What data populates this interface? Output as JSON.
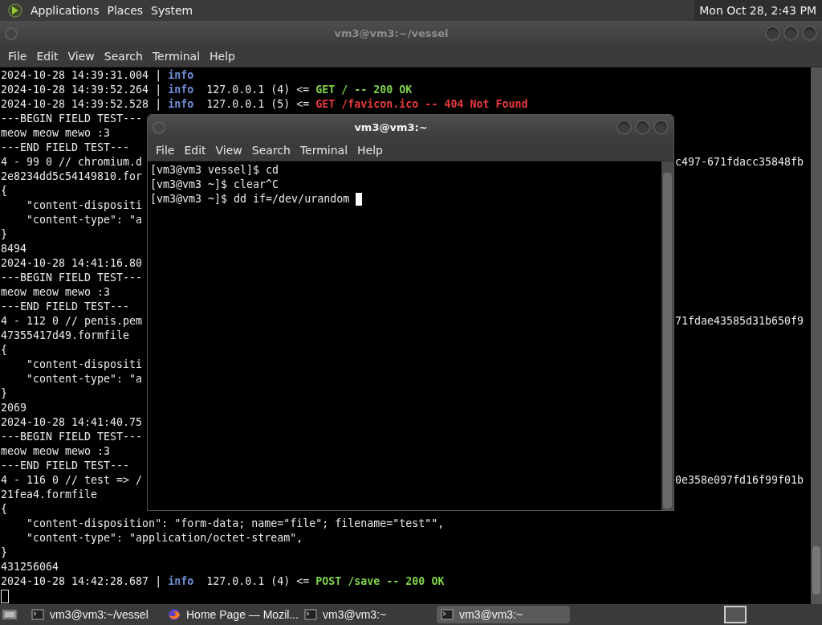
{
  "top_panel": {
    "menus": [
      "Applications",
      "Places",
      "System"
    ],
    "clock": "Mon Oct 28, 2:43 PM"
  },
  "windows": [
    {
      "title": "vm3@vm3:~/vessel",
      "active": false,
      "menu": [
        "File",
        "Edit",
        "View",
        "Search",
        "Terminal",
        "Help"
      ],
      "lines": [
        {
          "segments": [
            {
              "text": "2024-10-28 14:39:31.004 | ",
              "kind": "plain"
            },
            {
              "text": "info",
              "kind": "info"
            }
          ]
        },
        {
          "segments": [
            {
              "text": "2024-10-28 14:39:52.264 | ",
              "kind": "plain"
            },
            {
              "text": "info",
              "kind": "info"
            },
            {
              "text": "  127.0.0.1 (4) <= ",
              "kind": "plain"
            },
            {
              "text": "GET / -- 200 OK",
              "kind": "ok"
            }
          ]
        },
        {
          "segments": [
            {
              "text": "2024-10-28 14:39:52.528 | ",
              "kind": "plain"
            },
            {
              "text": "info",
              "kind": "info"
            },
            {
              "text": "  127.0.0.1 (5) <= ",
              "kind": "plain"
            },
            {
              "text": "GET /favicon.ico -- 404 Not Found",
              "kind": "error"
            }
          ]
        },
        {
          "segments": [
            {
              "text": "---BEGIN FIELD TEST---",
              "kind": "plain"
            }
          ]
        },
        {
          "segments": [
            {
              "text": "meow meow mewo :3",
              "kind": "plain"
            }
          ]
        },
        {
          "segments": [
            {
              "text": "---END FIELD TEST---",
              "kind": "plain"
            }
          ]
        },
        {
          "segments": [
            {
              "text": "4 - 99 0 // chromium.d",
              "kind": "plain"
            }
          ],
          "tail": "c497-671fdacc35848fb"
        },
        {
          "segments": [
            {
              "text": "2e8234dd5c54149810.for",
              "kind": "plain"
            }
          ]
        },
        {
          "segments": [
            {
              "text": "{",
              "kind": "plain"
            }
          ]
        },
        {
          "segments": [
            {
              "text": "    \"content-dispositi",
              "kind": "plain"
            }
          ]
        },
        {
          "segments": [
            {
              "text": "    \"content-type\": \"a",
              "kind": "plain"
            }
          ]
        },
        {
          "segments": [
            {
              "text": "}",
              "kind": "plain"
            }
          ]
        },
        {
          "segments": [
            {
              "text": "8494",
              "kind": "plain"
            }
          ]
        },
        {
          "segments": [
            {
              "text": "2024-10-28 14:41:16.80",
              "kind": "plain"
            }
          ]
        },
        {
          "segments": [
            {
              "text": "---BEGIN FIELD TEST---",
              "kind": "plain"
            }
          ]
        },
        {
          "segments": [
            {
              "text": "meow meow mewo :3",
              "kind": "plain"
            }
          ]
        },
        {
          "segments": [
            {
              "text": "---END FIELD TEST---",
              "kind": "plain"
            }
          ]
        },
        {
          "segments": [
            {
              "text": "4 - 112 0 // penis.pem",
              "kind": "plain"
            }
          ],
          "tail": "71fdae43585d31b650f9"
        },
        {
          "segments": [
            {
              "text": "47355417d49.formfile",
              "kind": "plain"
            }
          ]
        },
        {
          "segments": [
            {
              "text": "{",
              "kind": "plain"
            }
          ]
        },
        {
          "segments": [
            {
              "text": "    \"content-dispositi",
              "kind": "plain"
            }
          ]
        },
        {
          "segments": [
            {
              "text": "    \"content-type\": \"a",
              "kind": "plain"
            }
          ]
        },
        {
          "segments": [
            {
              "text": "}",
              "kind": "plain"
            }
          ]
        },
        {
          "segments": [
            {
              "text": "2069",
              "kind": "plain"
            }
          ]
        },
        {
          "segments": [
            {
              "text": "2024-10-28 14:41:40.75",
              "kind": "plain"
            }
          ]
        },
        {
          "segments": [
            {
              "text": "---BEGIN FIELD TEST---",
              "kind": "plain"
            }
          ]
        },
        {
          "segments": [
            {
              "text": "meow meow mewo :3",
              "kind": "plain"
            }
          ]
        },
        {
          "segments": [
            {
              "text": "---END FIELD TEST---",
              "kind": "plain"
            }
          ]
        },
        {
          "segments": [
            {
              "text": "4 - 116 0 // test => /",
              "kind": "plain"
            }
          ],
          "tail": "0e358e097fd16f99f01b"
        },
        {
          "segments": [
            {
              "text": "21fea4.formfile",
              "kind": "plain"
            }
          ]
        },
        {
          "segments": [
            {
              "text": "{",
              "kind": "plain"
            }
          ]
        },
        {
          "segments": [
            {
              "text": "    \"content-disposition\": \"form-data; name=\"file\"; filename=\"test\"\",",
              "kind": "plain"
            }
          ]
        },
        {
          "segments": [
            {
              "text": "    \"content-type\": \"application/octet-stream\",",
              "kind": "plain"
            }
          ]
        },
        {
          "segments": [
            {
              "text": "}",
              "kind": "plain"
            }
          ]
        },
        {
          "segments": [
            {
              "text": "431256064",
              "kind": "plain"
            }
          ]
        },
        {
          "segments": [
            {
              "text": "2024-10-28 14:42:28.687 | ",
              "kind": "plain"
            },
            {
              "text": "info",
              "kind": "info"
            },
            {
              "text": "  127.0.0.1 (4) <= ",
              "kind": "plain"
            },
            {
              "text": "POST /save -- 200 OK",
              "kind": "ok"
            }
          ]
        }
      ]
    },
    {
      "title": "vm3@vm3:~",
      "active": true,
      "menu": [
        "File",
        "Edit",
        "View",
        "Search",
        "Terminal",
        "Help"
      ],
      "lines": [
        {
          "segments": [
            {
              "text": "[vm3@vm3 vessel]$ cd",
              "kind": "plain"
            }
          ]
        },
        {
          "segments": [
            {
              "text": "[vm3@vm3 ~]$ clear^C",
              "kind": "plain"
            }
          ]
        },
        {
          "segments": [
            {
              "text": "[vm3@vm3 ~]$ dd if=/dev/urandom",
              "kind": "plain"
            }
          ]
        }
      ]
    }
  ],
  "taskbar": {
    "tasks": [
      {
        "label": "vm3@vm3:~/vessel",
        "kind": "terminal",
        "selected": false
      },
      {
        "label": "Home Page — Mozil...",
        "kind": "browser",
        "selected": false
      },
      {
        "label": "vm3@vm3:~",
        "kind": "terminal",
        "selected": false
      },
      {
        "label": "vm3@vm3:~",
        "kind": "terminal",
        "selected": true
      }
    ]
  }
}
